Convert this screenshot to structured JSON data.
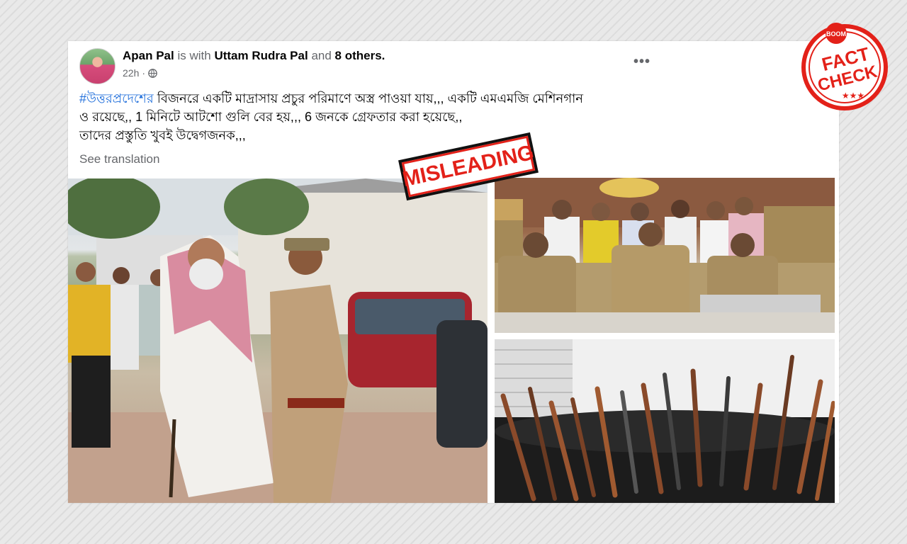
{
  "post": {
    "author": "Apan Pal",
    "with_text": "is with",
    "tagged": "Uttam Rudra Pal",
    "and_text": "and",
    "others": "8 others.",
    "time": "22h",
    "time_separator": "·",
    "more_label": "•••",
    "hashtag": "#উত্তরপ্রদেশের",
    "line1_rest": " বিজনরে একটি মাদ্রাসায় প্রচুর পরিমাণে অস্ত্র পাওয়া যায়,,, একটি এমএমজি মেশিনগান",
    "line2": "ও রয়েছে,, 1 মিনিটে আটশো গুলি বের হয়,,, 6 জনকে গ্রেফতার করা হয়েছে,,",
    "line3": "তাদের প্রস্তুতি খুবই উদ্বেগজনক,,,",
    "see_translation": "See translation"
  },
  "overlays": {
    "misleading_stamp": "MISLEADING",
    "boom_logo": "BOOM",
    "fact_text": "FACT",
    "check_text": "CHECK"
  },
  "colors": {
    "link": "#216fdb",
    "stamp_red": "#e32119",
    "text_primary": "#050505",
    "text_secondary": "#65676b"
  },
  "icons": [
    "globe-icon",
    "more-options-icon"
  ]
}
